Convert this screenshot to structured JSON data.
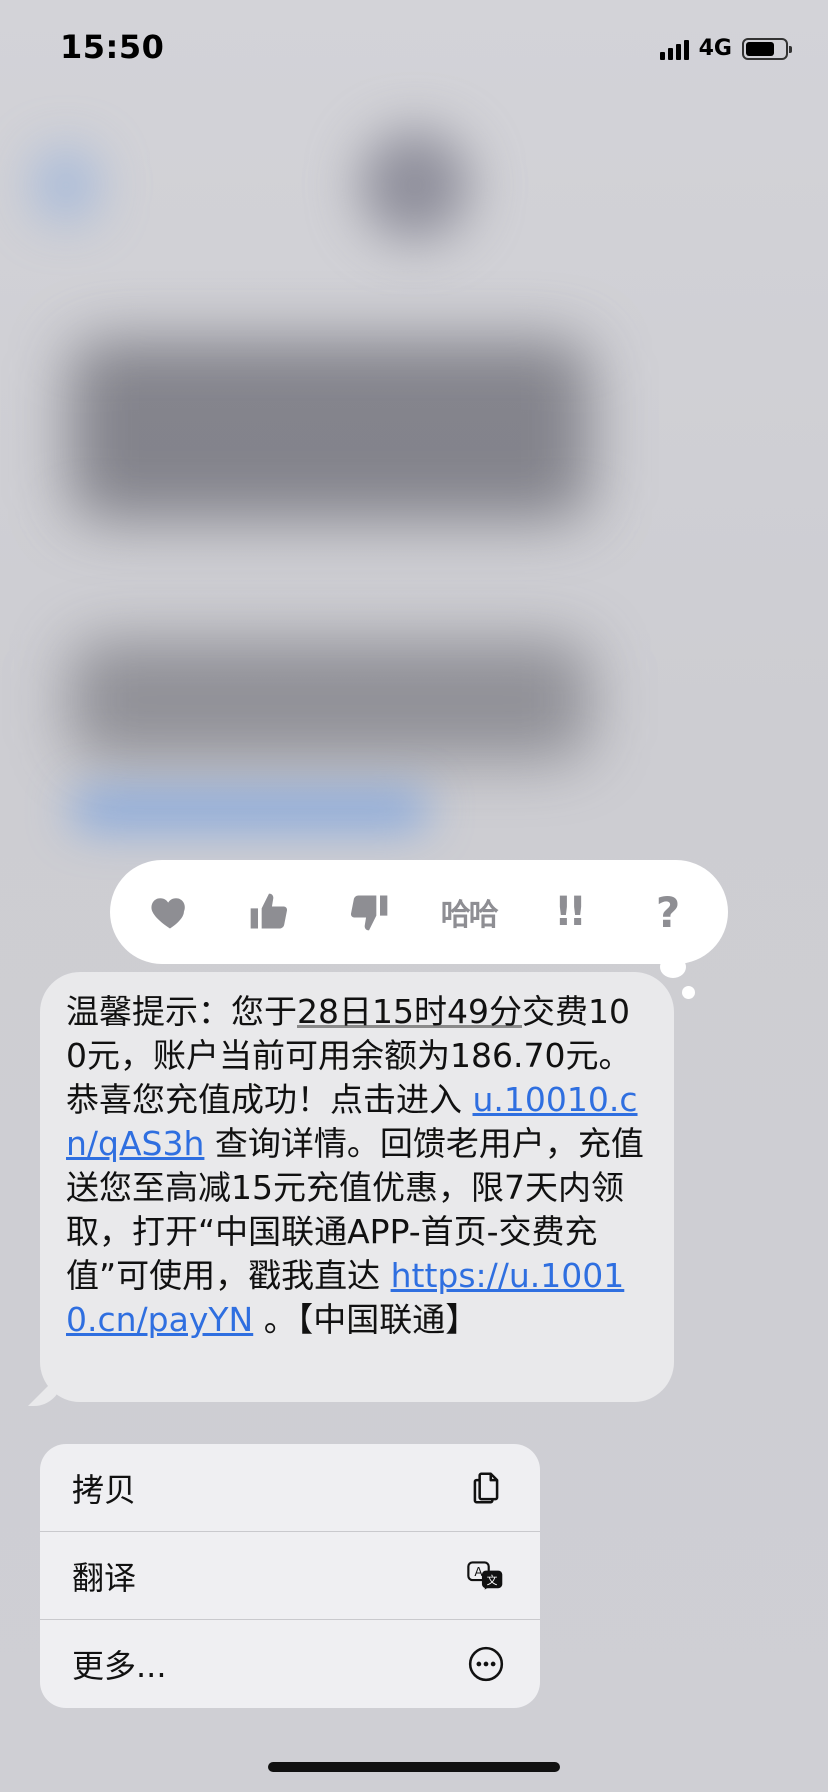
{
  "status_bar": {
    "time": "15:50",
    "network": "4G",
    "battery_level": 0.76
  },
  "tapback": {
    "reactions": [
      {
        "name": "heart",
        "icon": "heart-icon"
      },
      {
        "name": "thumbs-up",
        "icon": "thumbs-up-icon"
      },
      {
        "name": "thumbs-down",
        "icon": "thumbs-down-icon"
      },
      {
        "name": "haha",
        "icon": "haha-icon",
        "text": "哈哈"
      },
      {
        "name": "emphasize",
        "icon": "exclamation-icon",
        "text": "!!"
      },
      {
        "name": "question",
        "icon": "question-icon",
        "text": "?"
      }
    ]
  },
  "message": {
    "part1": "温馨提示：您于",
    "date_text": "28日15时49分",
    "part2": "交费100元，账户当前可用余额为186.70元。恭喜您充值成功！点击进入 ",
    "link1": "u.10010.cn/qAS3h",
    "part3": " 查询详情。回馈老用户，充值送您至高减15元充值优惠，限7天内领取，打开“中国联通APP-首页-交费充值”可使用，戳我直达 ",
    "link2": "https://u.10010.cn/payYN",
    "part4": " 。【中国联通】"
  },
  "context_menu": {
    "items": [
      {
        "label": "拷贝",
        "icon": "copy-icon"
      },
      {
        "label": "翻译",
        "icon": "translate-icon"
      },
      {
        "label": "更多...",
        "icon": "more-icon"
      }
    ]
  },
  "colors": {
    "link": "#2f6fe0",
    "bubble": "#e9e9eb",
    "tapback_icon": "#8e8e93"
  }
}
